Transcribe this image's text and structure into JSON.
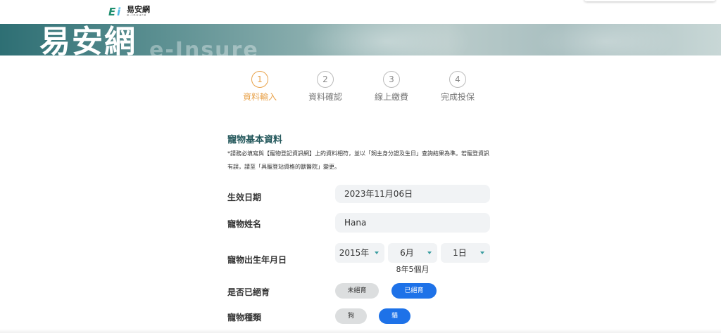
{
  "header": {
    "logo_name": "易安網",
    "logo_sub": "e-Insure"
  },
  "banner": {
    "title": "易安網",
    "subtitle": "e-Insure"
  },
  "steps": [
    {
      "number": "1",
      "label": "資料輸入",
      "active": true
    },
    {
      "number": "2",
      "label": "資料確認",
      "active": false
    },
    {
      "number": "3",
      "label": "線上繳費",
      "active": false
    },
    {
      "number": "4",
      "label": "完成投保",
      "active": false
    }
  ],
  "section": {
    "title": "寵物基本資料",
    "notice_line1": "*請務必填寫與【寵物登記資訊網】上的資料相符，並以「飼主身分證及生日」查詢結果為準。若寵登資訊",
    "notice_line2": "有誤，請至「具寵登站資格的獸醫院」變更。"
  },
  "form": {
    "effective_date": {
      "label": "生效日期",
      "value": "2023年11月06日"
    },
    "pet_name": {
      "label": "寵物姓名",
      "value": "Hana"
    },
    "birth": {
      "label": "寵物出生年月日",
      "year": "2015年",
      "month": "6月",
      "day": "1日",
      "age": "8年5個月"
    },
    "neutered": {
      "label": "是否已絕育",
      "options": [
        "未絕育",
        "已絕育"
      ],
      "selected": "已絕育"
    },
    "species": {
      "label": "寵物種類",
      "options": [
        "狗",
        "貓"
      ],
      "selected": "貓"
    }
  },
  "colors": {
    "accent_step": "#e8a24a",
    "title": "#23575b",
    "selected_pill": "#1e72e8",
    "caret": "#3a9da0"
  }
}
